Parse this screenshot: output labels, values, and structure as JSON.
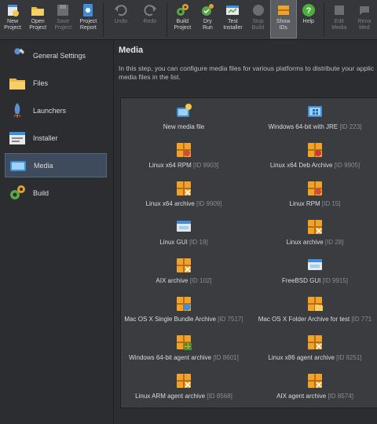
{
  "toolbar": {
    "new_project": "New\nProject",
    "open_project": "Open\nProject",
    "save_project": "Save\nProject",
    "project_report": "Project\nReport",
    "undo": "Undo",
    "redo": "Redo",
    "build_project": "Build\nProject",
    "dry_run": "Dry\nRun",
    "test_installer": "Test\nInstaller",
    "stop_build": "Stop\nBuild",
    "show_ids": "Show\nIDs",
    "help": "Help",
    "edit_media": "Edit\nMedia",
    "rename_media": "Rena\nMed"
  },
  "sidebar": {
    "items": [
      {
        "label": "General Settings",
        "icon": "wrench-icon"
      },
      {
        "label": "Files",
        "icon": "folder-icon"
      },
      {
        "label": "Launchers",
        "icon": "rocket-icon"
      },
      {
        "label": "Installer",
        "icon": "installer-icon"
      },
      {
        "label": "Media",
        "icon": "media-icon",
        "selected": true
      },
      {
        "label": "Build",
        "icon": "gears-icon"
      }
    ]
  },
  "main": {
    "title": "Media",
    "description_line1": "In this step, you can configure media files for various platforms to distribute your applic",
    "description_line2": "media files in the list."
  },
  "media": [
    {
      "name": "New media file",
      "id": "",
      "icon": "new-media-icon"
    },
    {
      "name": "Windows 64-bit with JRE",
      "id": "[ID 223]",
      "icon": "windows-media-icon"
    },
    {
      "name": "Linux x64 RPM",
      "id": "[ID 9903]",
      "icon": "rpm-archive-icon"
    },
    {
      "name": "Linux x64 Deb Archive",
      "id": "[ID 9905]",
      "icon": "deb-archive-icon"
    },
    {
      "name": "Linux x64 archive",
      "id": "[ID 9909]",
      "icon": "tar-archive-icon"
    },
    {
      "name": "Linux RPM",
      "id": "[ID 15]",
      "icon": "rpm-archive-icon"
    },
    {
      "name": "Linux GUI",
      "id": "[ID 19]",
      "icon": "linux-gui-icon"
    },
    {
      "name": "Linux archive",
      "id": "[ID 28]",
      "icon": "tar-archive-icon"
    },
    {
      "name": "AIX archive",
      "id": "[ID 102]",
      "icon": "tar-archive-icon"
    },
    {
      "name": "FreeBSD GUI",
      "id": "[ID 9915]",
      "icon": "linux-gui-icon"
    },
    {
      "name": "Mac OS X Single Bundle Archive",
      "id": "[ID 7517]",
      "icon": "mac-bundle-icon"
    },
    {
      "name": "Mac OS X Folder Archive for test",
      "id": "[ID 771",
      "icon": "mac-folder-icon"
    },
    {
      "name": "Windows 64-bit agent archive",
      "id": "[ID 8601]",
      "icon": "windows-archive-icon"
    },
    {
      "name": "Linux x86 agent archive",
      "id": "[ID 8251]",
      "icon": "tar-archive-icon"
    },
    {
      "name": "Linux ARM agent archive",
      "id": "[ID 8568]",
      "icon": "tar-archive-icon"
    },
    {
      "name": "AIX agent archive",
      "id": "[ID 8574]",
      "icon": "tar-archive-icon"
    }
  ],
  "colors": {
    "background": "#2b2d30",
    "panel": "#3a3c40",
    "selected": "#3d4b5c",
    "archive_orange": "#f0a22a"
  }
}
